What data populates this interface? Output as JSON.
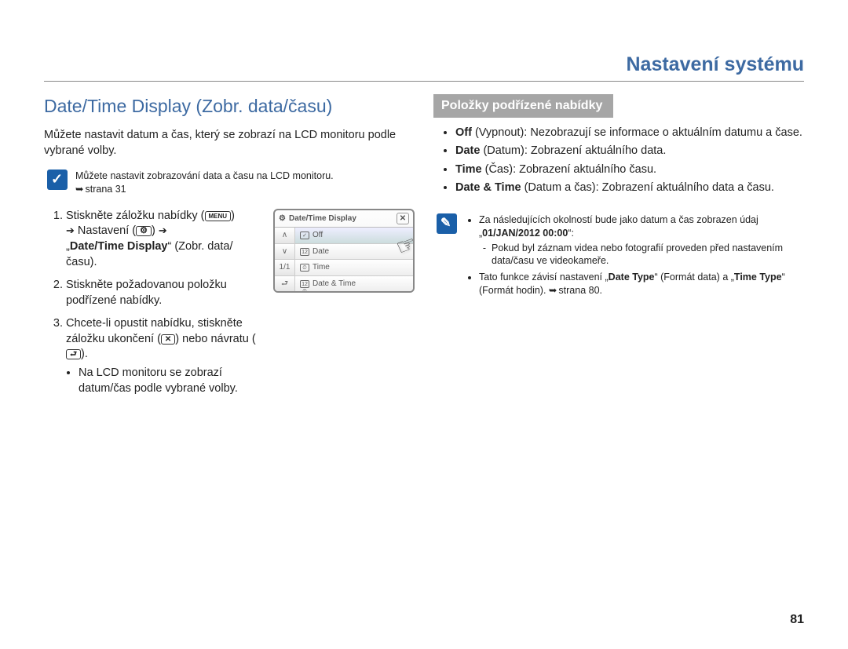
{
  "header": {
    "title": "Nastavení systému"
  },
  "left": {
    "section_title": "Date/Time Display (Zobr. data/času)",
    "intro": "Můžete nastavit datum a čas, který se zobrazí na LCD monitoru podle vybrané volby.",
    "note1_line1": "Můžete nastavit zobrazování data a času na LCD monitoru.",
    "note1_line2": "strana 31",
    "menu_pill": "MENU",
    "step1_a": "Stiskněte záložku nabídky (",
    "step1_b": ") ",
    "step1_c": " Nastavení (",
    "step1_d": ") ",
    "step1_e": " „",
    "step1_bold": "Date/Time Display",
    "step1_f": "“ (Zobr. data/času).",
    "step2": "Stiskněte požadovanou položku podřízené nabídky.",
    "step3_a": "Chcete-li opustit nabídku, stiskněte záložku ukončení (",
    "step3_b": ") nebo návratu (",
    "step3_c": ").",
    "step3_bullet": "Na LCD monitoru se zobrazí datum/čas podle vybrané volby.",
    "arrow": "➔"
  },
  "lcd": {
    "title": "Date/Time Display",
    "side_up": "∧",
    "side_dn": "∨",
    "side_pg": "1/1",
    "side_back": "⮐",
    "rows": [
      "Off",
      "Date",
      "Time",
      "Date & Time"
    ],
    "row_icons": [
      "✓",
      "12",
      "⏲",
      "12⏲"
    ]
  },
  "right": {
    "sub_heading": "Položky podřízené nabídky",
    "b1_bold": "Off",
    "b1_rest": " (Vypnout): Nezobrazují se informace o aktuálním datumu a čase.",
    "b2_bold": "Date",
    "b2_rest": " (Datum): Zobrazení aktuálního data.",
    "b3_bold": "Time",
    "b3_rest": " (Čas): Zobrazení aktuálního času.",
    "b4_bold": "Date & Time",
    "b4_rest": " (Datum a čas): Zobrazení aktuálního data a času.",
    "n2_li1_a": "Za následujících okolností bude jako datum a čas zobrazen údaj „",
    "n2_li1_bold": "01/JAN/2012 00:00",
    "n2_li1_b": "“:",
    "n2_li1_sub": "Pokud byl záznam videa nebo fotografií proveden před nastavením data/času ve videokameře.",
    "n2_li2_a": "Tato funkce závisí nastavení „",
    "n2_li2_bold1": "Date Type",
    "n2_li2_b": "“ (Formát data) a „",
    "n2_li2_bold2": "Time Type",
    "n2_li2_c": "“ (Formát hodin). ",
    "n2_li2_ref": "strana 80."
  },
  "page_number": "81"
}
